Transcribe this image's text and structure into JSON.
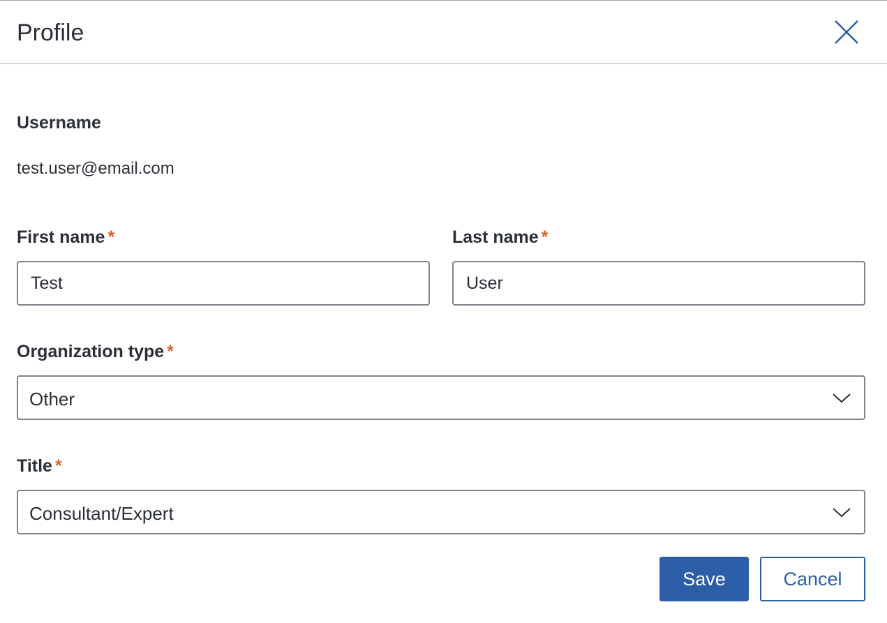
{
  "dialog": {
    "title": "Profile"
  },
  "username": {
    "label": "Username",
    "value": "test.user@email.com"
  },
  "first_name": {
    "label": "First name",
    "required_mark": "*",
    "value": "Test"
  },
  "last_name": {
    "label": "Last name",
    "required_mark": "*",
    "value": "User"
  },
  "organization_type": {
    "label": "Organization type",
    "required_mark": "*",
    "selected": "Other"
  },
  "title_field": {
    "label": "Title",
    "required_mark": "*",
    "selected": "Consultant/Expert"
  },
  "actions": {
    "save_label": "Save",
    "cancel_label": "Cancel"
  },
  "icons": {
    "close": "close-icon",
    "chevron": "chevron-down-icon"
  },
  "colors": {
    "primary": "#2b5ea7",
    "required": "#d9622b",
    "text": "#2b2f36",
    "border": "#7d848c",
    "divider": "#d3dbe0"
  }
}
